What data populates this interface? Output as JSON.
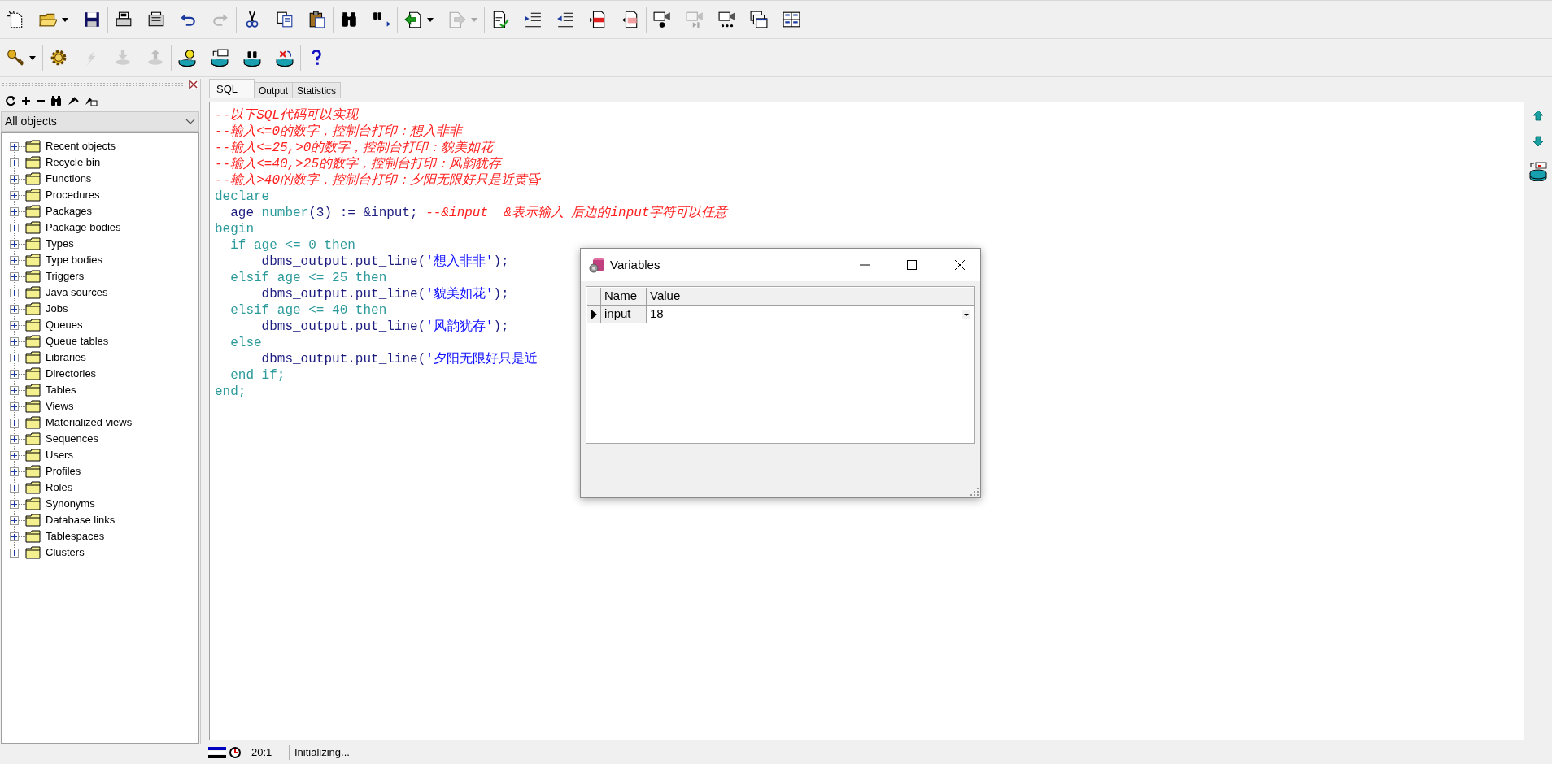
{
  "toolbars": [
    [
      [
        {
          "kind": "new",
          "disabled": false
        },
        {
          "kind": "open",
          "disabled": false
        },
        {
          "kind": "dropdown",
          "disabled": false
        },
        {
          "kind": "save",
          "disabled": false
        }
      ],
      [
        {
          "kind": "print",
          "disabled": false
        },
        {
          "kind": "print_setup",
          "disabled": false
        }
      ],
      [
        {
          "kind": "undo",
          "disabled": false
        },
        {
          "kind": "redo",
          "disabled": true
        }
      ],
      [
        {
          "kind": "cut",
          "disabled": false
        },
        {
          "kind": "copy",
          "disabled": false
        },
        {
          "kind": "paste",
          "disabled": false
        }
      ],
      [
        {
          "kind": "find",
          "disabled": false
        },
        {
          "kind": "find_next",
          "disabled": false
        }
      ],
      [
        {
          "kind": "import",
          "disabled": false
        },
        {
          "kind": "dropdown",
          "disabled": false
        },
        {
          "kind": "export",
          "disabled": true
        },
        {
          "kind": "dropdown",
          "disabled": true
        }
      ],
      [
        {
          "kind": "check",
          "disabled": false
        },
        {
          "kind": "indent",
          "disabled": false
        },
        {
          "kind": "outdent",
          "disabled": false
        },
        {
          "kind": "page_in",
          "disabled": false
        },
        {
          "kind": "page_out",
          "disabled": false
        }
      ],
      [
        {
          "kind": "camera_record",
          "disabled": false
        },
        {
          "kind": "camera_step",
          "disabled": true
        },
        {
          "kind": "camera_more",
          "disabled": false
        }
      ],
      [
        {
          "kind": "windows",
          "disabled": false
        },
        {
          "kind": "tiles",
          "disabled": false
        }
      ]
    ],
    [
      [
        {
          "kind": "key",
          "disabled": false
        },
        {
          "kind": "dropdown",
          "disabled": false
        }
      ],
      [
        {
          "kind": "gear",
          "disabled": false
        },
        {
          "kind": "lightning",
          "disabled": true
        }
      ],
      [
        {
          "kind": "db_down",
          "disabled": true
        },
        {
          "kind": "db_up",
          "disabled": true
        }
      ],
      [
        {
          "kind": "db_bulb",
          "disabled": false
        },
        {
          "kind": "db_sql",
          "disabled": false
        },
        {
          "kind": "db_find",
          "disabled": false
        },
        {
          "kind": "db_delete",
          "disabled": false
        }
      ],
      [
        {
          "kind": "help",
          "disabled": false
        }
      ]
    ]
  ],
  "object_browser": {
    "filter": "All objects",
    "items": [
      {
        "label": "Recent objects",
        "expanded": false
      },
      {
        "label": "Recycle bin",
        "expanded": false
      },
      {
        "label": "Functions",
        "expanded": false
      },
      {
        "label": "Procedures",
        "expanded": false
      },
      {
        "label": "Packages",
        "expanded": false
      },
      {
        "label": "Package bodies",
        "expanded": false
      },
      {
        "label": "Types",
        "expanded": false
      },
      {
        "label": "Type bodies",
        "expanded": false
      },
      {
        "label": "Triggers",
        "expanded": false
      },
      {
        "label": "Java sources",
        "expanded": false
      },
      {
        "label": "Jobs",
        "expanded": false
      },
      {
        "label": "Queues",
        "expanded": false
      },
      {
        "label": "Queue tables",
        "expanded": false
      },
      {
        "label": "Libraries",
        "expanded": false
      },
      {
        "label": "Directories",
        "expanded": false
      },
      {
        "label": "Tables",
        "expanded": false
      },
      {
        "label": "Views",
        "expanded": false
      },
      {
        "label": "Materialized views",
        "expanded": false
      },
      {
        "label": "Sequences",
        "expanded": false
      },
      {
        "label": "Users",
        "expanded": false
      },
      {
        "label": "Profiles",
        "expanded": false
      },
      {
        "label": "Roles",
        "expanded": false
      },
      {
        "label": "Synonyms",
        "expanded": false
      },
      {
        "label": "Database links",
        "expanded": false
      },
      {
        "label": "Tablespaces",
        "expanded": false
      },
      {
        "label": "Clusters",
        "expanded": false
      }
    ]
  },
  "tabs": [
    {
      "label": "SQL",
      "selected": true
    },
    {
      "label": "Output",
      "selected": false
    },
    {
      "label": "Statistics",
      "selected": false
    }
  ],
  "editor": {
    "lines": [
      [
        {
          "kind": "comment",
          "text": "--以下SQL代码可以实现"
        }
      ],
      [
        {
          "kind": "comment",
          "text": "--输入<=0的数字，控制台打印：想入非非"
        }
      ],
      [
        {
          "kind": "comment",
          "text": "--输入<=25,>0的数字，控制台打印：貌美如花"
        }
      ],
      [
        {
          "kind": "comment",
          "text": "--输入<=40,>25的数字，控制台打印：风韵犹存"
        }
      ],
      [
        {
          "kind": "comment",
          "text": "--输入>40的数字，控制台打印：夕阳无限好只是近黄昏"
        }
      ],
      [
        {
          "kind": "keyword",
          "text": "declare"
        }
      ],
      [
        {
          "kind": "plain",
          "text": "  age "
        },
        {
          "kind": "keyword",
          "text": "number"
        },
        {
          "kind": "plain",
          "text": "(3) := &input; "
        },
        {
          "kind": "comment",
          "text": "--&input  &表示输入 后边的input字符可以任意"
        }
      ],
      [
        {
          "kind": "keyword",
          "text": "begin"
        }
      ],
      [
        {
          "kind": "keyword",
          "text": "  if age <= 0 then"
        }
      ],
      [
        {
          "kind": "plain",
          "text": "      dbms_output.put_line("
        },
        {
          "kind": "string",
          "text": "'想入非非'"
        },
        {
          "kind": "plain",
          "text": ");"
        }
      ],
      [
        {
          "kind": "keyword",
          "text": "  elsif age <= 25 then"
        }
      ],
      [
        {
          "kind": "plain",
          "text": "      dbms_output.put_line("
        },
        {
          "kind": "string",
          "text": "'貌美如花'"
        },
        {
          "kind": "plain",
          "text": ");"
        }
      ],
      [
        {
          "kind": "keyword",
          "text": "  elsif age <= 40 then"
        }
      ],
      [
        {
          "kind": "plain",
          "text": "      dbms_output.put_line("
        },
        {
          "kind": "string",
          "text": "'风韵犹存'"
        },
        {
          "kind": "plain",
          "text": ");"
        }
      ],
      [
        {
          "kind": "keyword",
          "text": "  else"
        }
      ],
      [
        {
          "kind": "plain",
          "text": "      dbms_output.put_line("
        },
        {
          "kind": "string",
          "text": "'夕阳无限好只是近"
        }
      ],
      [
        {
          "kind": "keyword",
          "text": "  end if;"
        }
      ],
      [
        {
          "kind": "keyword",
          "text": "end;"
        }
      ]
    ]
  },
  "variables_dialog": {
    "title": "Variables",
    "columns": [
      "Name",
      "Value"
    ],
    "rows": [
      {
        "name": "input",
        "value": "18",
        "selected": true
      }
    ]
  },
  "status_bar": {
    "position": "20:1",
    "message": "Initializing..."
  }
}
